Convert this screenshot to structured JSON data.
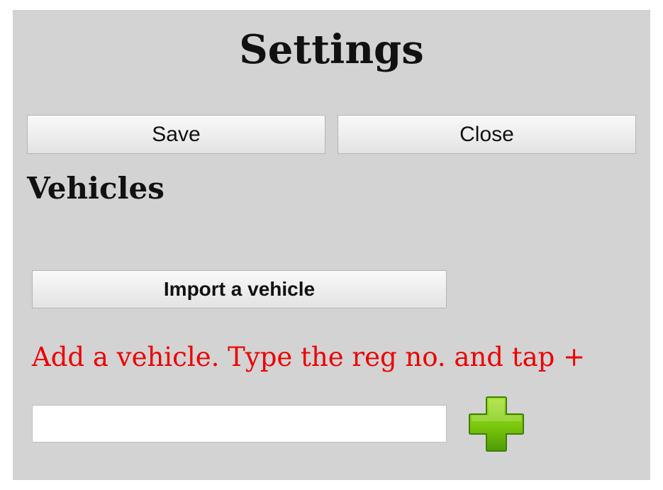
{
  "header": {
    "title": "Settings"
  },
  "toolbar": {
    "save_label": "Save",
    "close_label": "Close"
  },
  "vehicles": {
    "heading": "Vehicles",
    "import_label": "Import a vehicle",
    "add_hint": "Add a vehicle. Type the reg no. and tap +",
    "reg_input_value": "",
    "add_icon": "plus-icon"
  },
  "colors": {
    "panel_background": "#d3d3d3",
    "hint_text": "#ee0000",
    "add_icon_green": "#7ac70c"
  }
}
